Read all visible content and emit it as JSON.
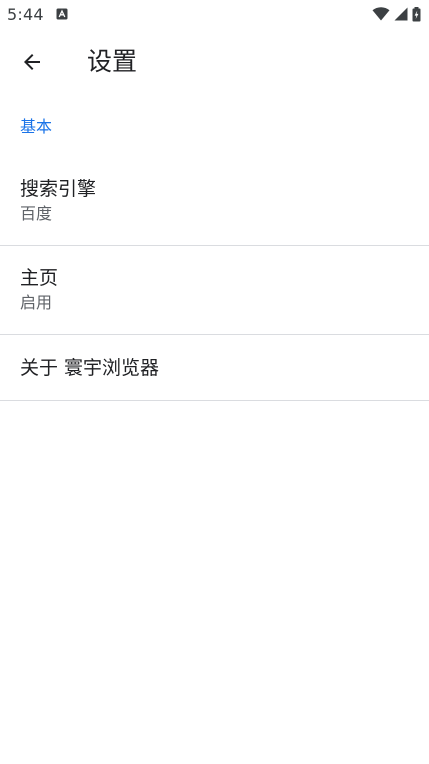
{
  "status_bar": {
    "time": "5:44",
    "icons": [
      "notification-a-icon",
      "wifi-icon",
      "signal-icon",
      "battery-charging-icon"
    ]
  },
  "app_bar": {
    "back_icon": "arrow-left-icon",
    "title": "设置"
  },
  "section": {
    "title": "基本",
    "accent_color": "#1a73e8"
  },
  "preferences": [
    {
      "title": "搜索引擎",
      "summary": "百度"
    },
    {
      "title": "主页",
      "summary": "启用"
    },
    {
      "title": "关于 寰宇浏览器"
    }
  ]
}
